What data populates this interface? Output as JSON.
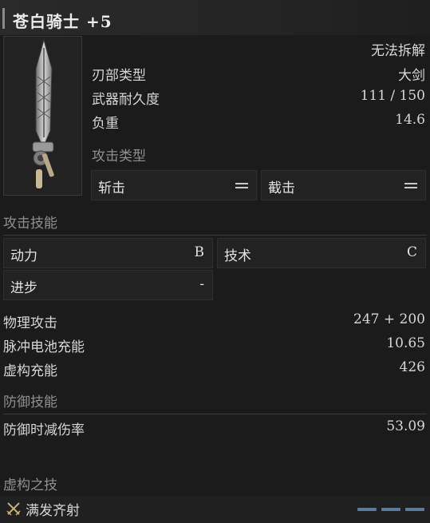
{
  "title": "苍白骑士 +5",
  "item": {
    "status": "无法拆解",
    "stats": [
      {
        "label": "刃部类型",
        "value": "大剑"
      },
      {
        "label": "武器耐久度",
        "value": "111 / 150"
      },
      {
        "label": "负重",
        "value": "14.6"
      }
    ],
    "attack_type_heading": "攻击类型",
    "attack_types": [
      {
        "label": "斩击",
        "icon": "equals-icon"
      },
      {
        "label": "截击",
        "icon": "equals-icon"
      }
    ]
  },
  "attack_skills": {
    "heading": "攻击技能",
    "items": [
      {
        "label": "动力",
        "value": "B"
      },
      {
        "label": "技术",
        "value": "C"
      },
      {
        "label": "进步",
        "value": "-"
      }
    ]
  },
  "attack_stats": [
    {
      "label": "物理攻击",
      "value": "247 + 200"
    },
    {
      "label": "脉冲电池充能",
      "value": "10.65"
    },
    {
      "label": "虚构充能",
      "value": "426"
    }
  ],
  "defense": {
    "heading": "防御技能",
    "label": "防御时减伤率",
    "value": "53.09"
  },
  "fable": {
    "heading": "虚构之技",
    "skill": "满发齐射",
    "charge_color": "#5c7a9e"
  }
}
